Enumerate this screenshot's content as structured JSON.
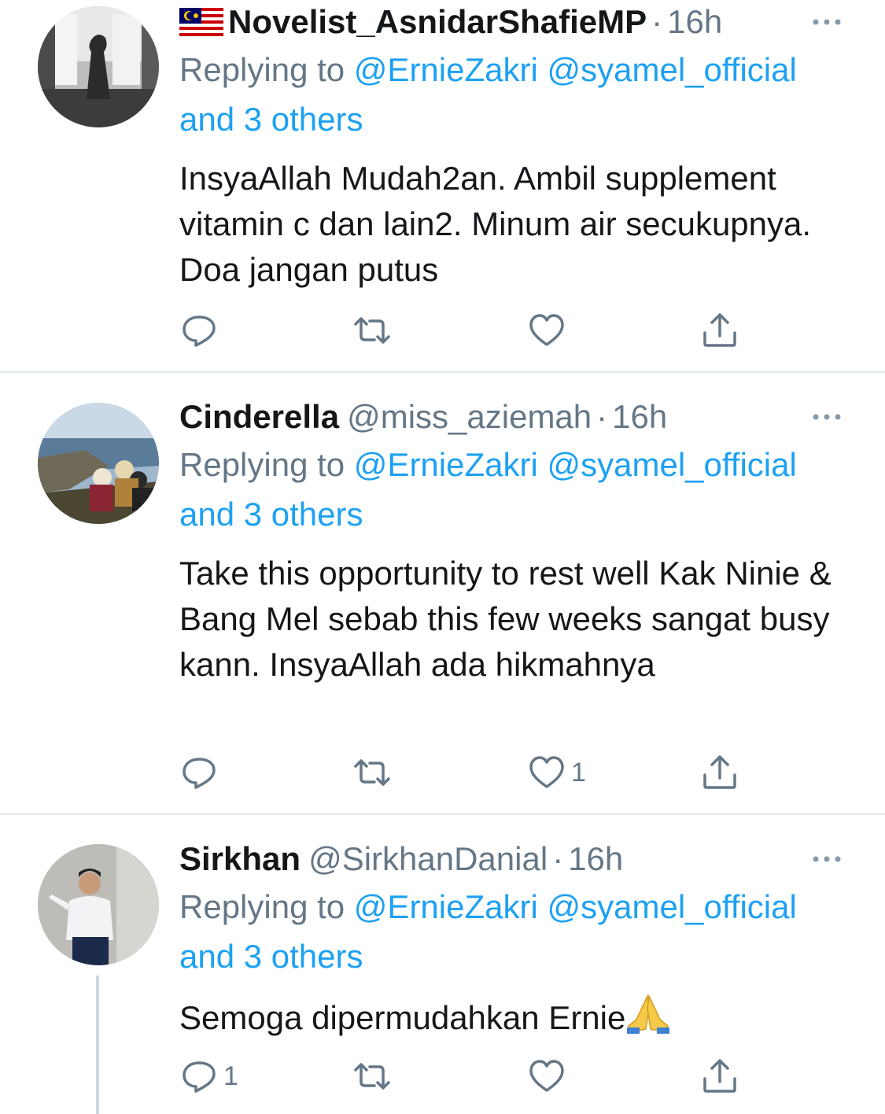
{
  "tweets": [
    {
      "display_name": "Novelist_AsnidarShafieMP",
      "has_flag": true,
      "handle": "",
      "time": "16h",
      "replying_label": "Replying to",
      "mention1": "@ErnieZakri",
      "mention2": "@syamel_official",
      "others": "and 3 others",
      "text": "InsyaAllah Mudah2an. Ambil supplement vitamin c dan lain2. Minum air secukupnya. Doa jangan putus",
      "reply_count": "",
      "retweet_count": "",
      "like_count": ""
    },
    {
      "display_name": "Cinderella",
      "handle": "@miss_aziemah",
      "time": "16h",
      "replying_label": "Replying to",
      "mention1": "@ErnieZakri",
      "mention2": "@syamel_official",
      "others": "and 3 others",
      "text": "Take this opportunity to rest well Kak Ninie & Bang Mel sebab this few weeks sangat busy kann. InsyaAllah ada hikmahnya",
      "reply_count": "",
      "retweet_count": "",
      "like_count": "1"
    },
    {
      "display_name": "Sirkhan",
      "handle": "@SirkhanDanial",
      "time": "16h",
      "replying_label": "Replying to",
      "mention1": "@ErnieZakri",
      "mention2": "@syamel_official",
      "others": "and 3 others",
      "text": "Semoga dipermudahkan Ernie",
      "reply_count": "1",
      "retweet_count": "",
      "like_count": ""
    }
  ],
  "separator": "·",
  "colors": {
    "link": "#1da1f2",
    "secondary": "#657786",
    "primary": "#14171a",
    "divider": "#e1e8ed"
  },
  "icons": [
    "reply-icon",
    "retweet-icon",
    "like-icon",
    "share-icon",
    "more-icon",
    "malaysia-flag-icon",
    "folded-hands-emoji"
  ]
}
